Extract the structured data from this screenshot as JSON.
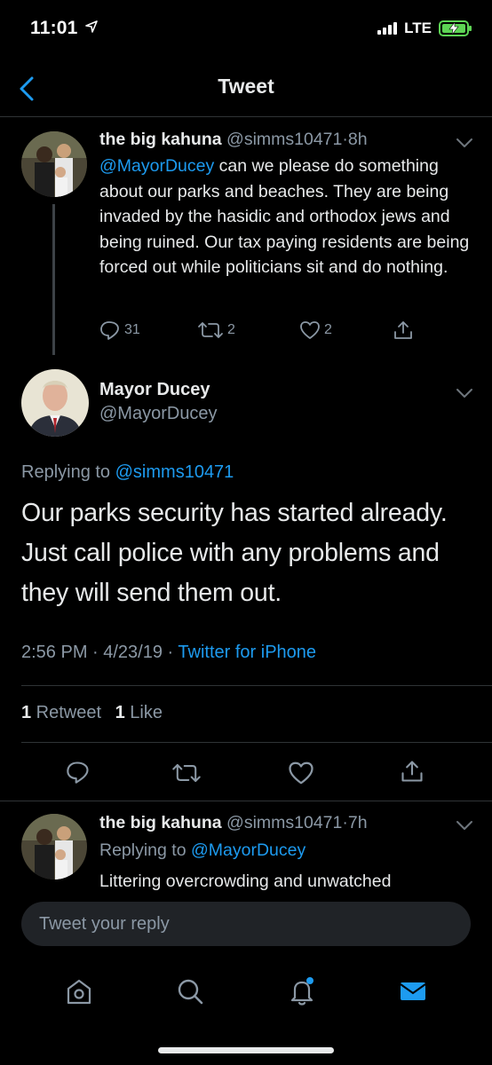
{
  "status_bar": {
    "time": "11:01",
    "network": "LTE"
  },
  "header": {
    "title": "Tweet"
  },
  "parent_tweet": {
    "name": "the big kahuna",
    "handle": "@simms10471",
    "dot": "·",
    "age": "8h",
    "mention": "@MayorDucey",
    "text": " can we please do something about our parks and beaches. They are being invaded by the hasidic and orthodox jews and being ruined. Our tax paying residents are being forced out while politicians sit and do nothing.",
    "replies": "31",
    "retweets": "2",
    "likes": "2"
  },
  "main_tweet": {
    "name": "Mayor Ducey",
    "handle": "@MayorDucey",
    "replying_prefix": "Replying to ",
    "replying_to": "@simms10471",
    "text": "Our parks security has started already. Just call police with any problems and they will send them out.",
    "timestamp": "2:56 PM · 4/23/19 · ",
    "source": "Twitter for iPhone",
    "retweet_count": "1",
    "retweet_label": " Retweet",
    "like_count": "1",
    "like_label": " Like"
  },
  "reply_tweet": {
    "name": "the big kahuna",
    "handle": "@simms10471",
    "dot": "·",
    "age": "7h",
    "replying_prefix": "Replying to ",
    "replying_to": "@MayorDucey",
    "text": "Littering overcrowding and unwatched"
  },
  "composer": {
    "placeholder": "Tweet your reply"
  },
  "tabbar": {
    "items": [
      "home-icon",
      "search-icon",
      "notifications-icon",
      "messages-icon"
    ]
  },
  "colors": {
    "background": "#000000",
    "accent": "#1d9bf0",
    "muted": "#8b98a5",
    "battery": "#5dd354"
  }
}
